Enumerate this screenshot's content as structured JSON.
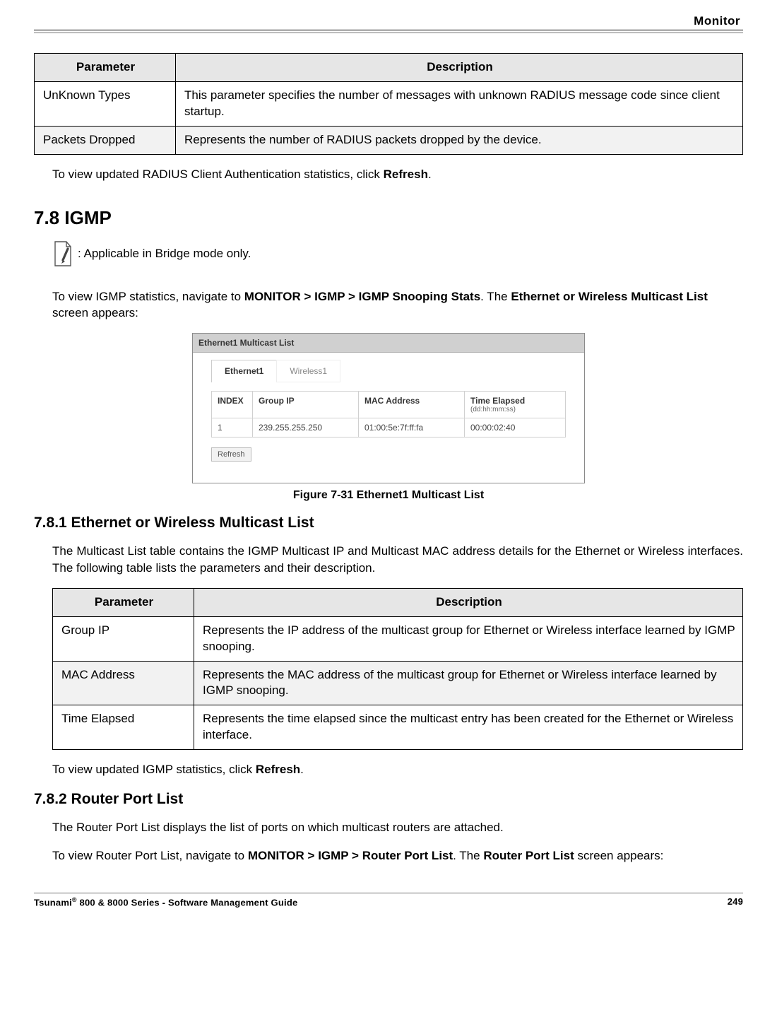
{
  "header": {
    "running_title": "Monitor"
  },
  "table_radius": {
    "headers": {
      "param": "Parameter",
      "desc": "Description"
    },
    "rows": [
      {
        "param": "UnKnown Types",
        "desc": "This parameter specifies the number of messages with unknown RADIUS message code since client startup."
      },
      {
        "param": "Packets Dropped",
        "desc": "Represents the number of RADIUS packets dropped by the device."
      }
    ]
  },
  "radius_after": {
    "pre": "To view updated RADIUS Client Authentication statistics, click ",
    "bold": "Refresh",
    "post": "."
  },
  "igmp": {
    "heading": "7.8 IGMP",
    "note": ": Applicable in Bridge mode only.",
    "nav_sentence": {
      "p1": "To view IGMP statistics, navigate to ",
      "b1": "MONITOR > IGMP > IGMP Snooping Stats",
      "p2": ". The ",
      "b2": "Ethernet or Wireless Multicast List",
      "p3": " screen appears:"
    }
  },
  "screenshot": {
    "panel_title": "Ethernet1 Multicast List",
    "tabs": {
      "active": "Ethernet1",
      "inactive": "Wireless1"
    },
    "grid": {
      "headers": {
        "index": "INDEX",
        "group_ip": "Group IP",
        "mac": "MAC Address",
        "time": "Time Elapsed",
        "time_sub": "(dd:hh:mm:ss)"
      },
      "row": {
        "index": "1",
        "group_ip": "239.255.255.250",
        "mac": "01:00:5e:7f:ff:fa",
        "time": "00:00:02:40"
      }
    },
    "refresh": "Refresh"
  },
  "figure_caption": "Figure 7-31 Ethernet1 Multicast List",
  "section_781": {
    "heading": "7.8.1 Ethernet or Wireless Multicast List",
    "intro": "The Multicast List table contains the IGMP Multicast IP and Multicast MAC address details for the Ethernet or Wireless interfaces. The following table lists the parameters and their description.",
    "table": {
      "headers": {
        "param": "Parameter",
        "desc": "Description"
      },
      "rows": [
        {
          "param": "Group IP",
          "desc": "Represents the IP address of the multicast group for Ethernet or Wireless interface learned by IGMP snooping."
        },
        {
          "param": "MAC Address",
          "desc": "Represents the MAC address of the multicast group for Ethernet or Wireless interface learned by IGMP snooping."
        },
        {
          "param": "Time Elapsed",
          "desc": "Represents the time elapsed since the multicast entry has been created for the Ethernet or Wireless interface."
        }
      ]
    },
    "after": {
      "pre": "To view updated IGMP statistics, click ",
      "bold": "Refresh",
      "post": "."
    }
  },
  "section_782": {
    "heading": "7.8.2 Router Port List",
    "p1": "The Router Port List displays the list of ports on which multicast routers are attached.",
    "p2_pre": "To view Router Port List, navigate to ",
    "p2_b1": "MONITOR > IGMP > Router Port List",
    "p2_mid": ". The ",
    "p2_b2": "Router Port List",
    "p2_post": " screen appears:"
  },
  "footer": {
    "left_pre": "Tsunami",
    "left_post": " 800 & 8000 Series - Software Management Guide",
    "reg": "®",
    "page": "249"
  }
}
